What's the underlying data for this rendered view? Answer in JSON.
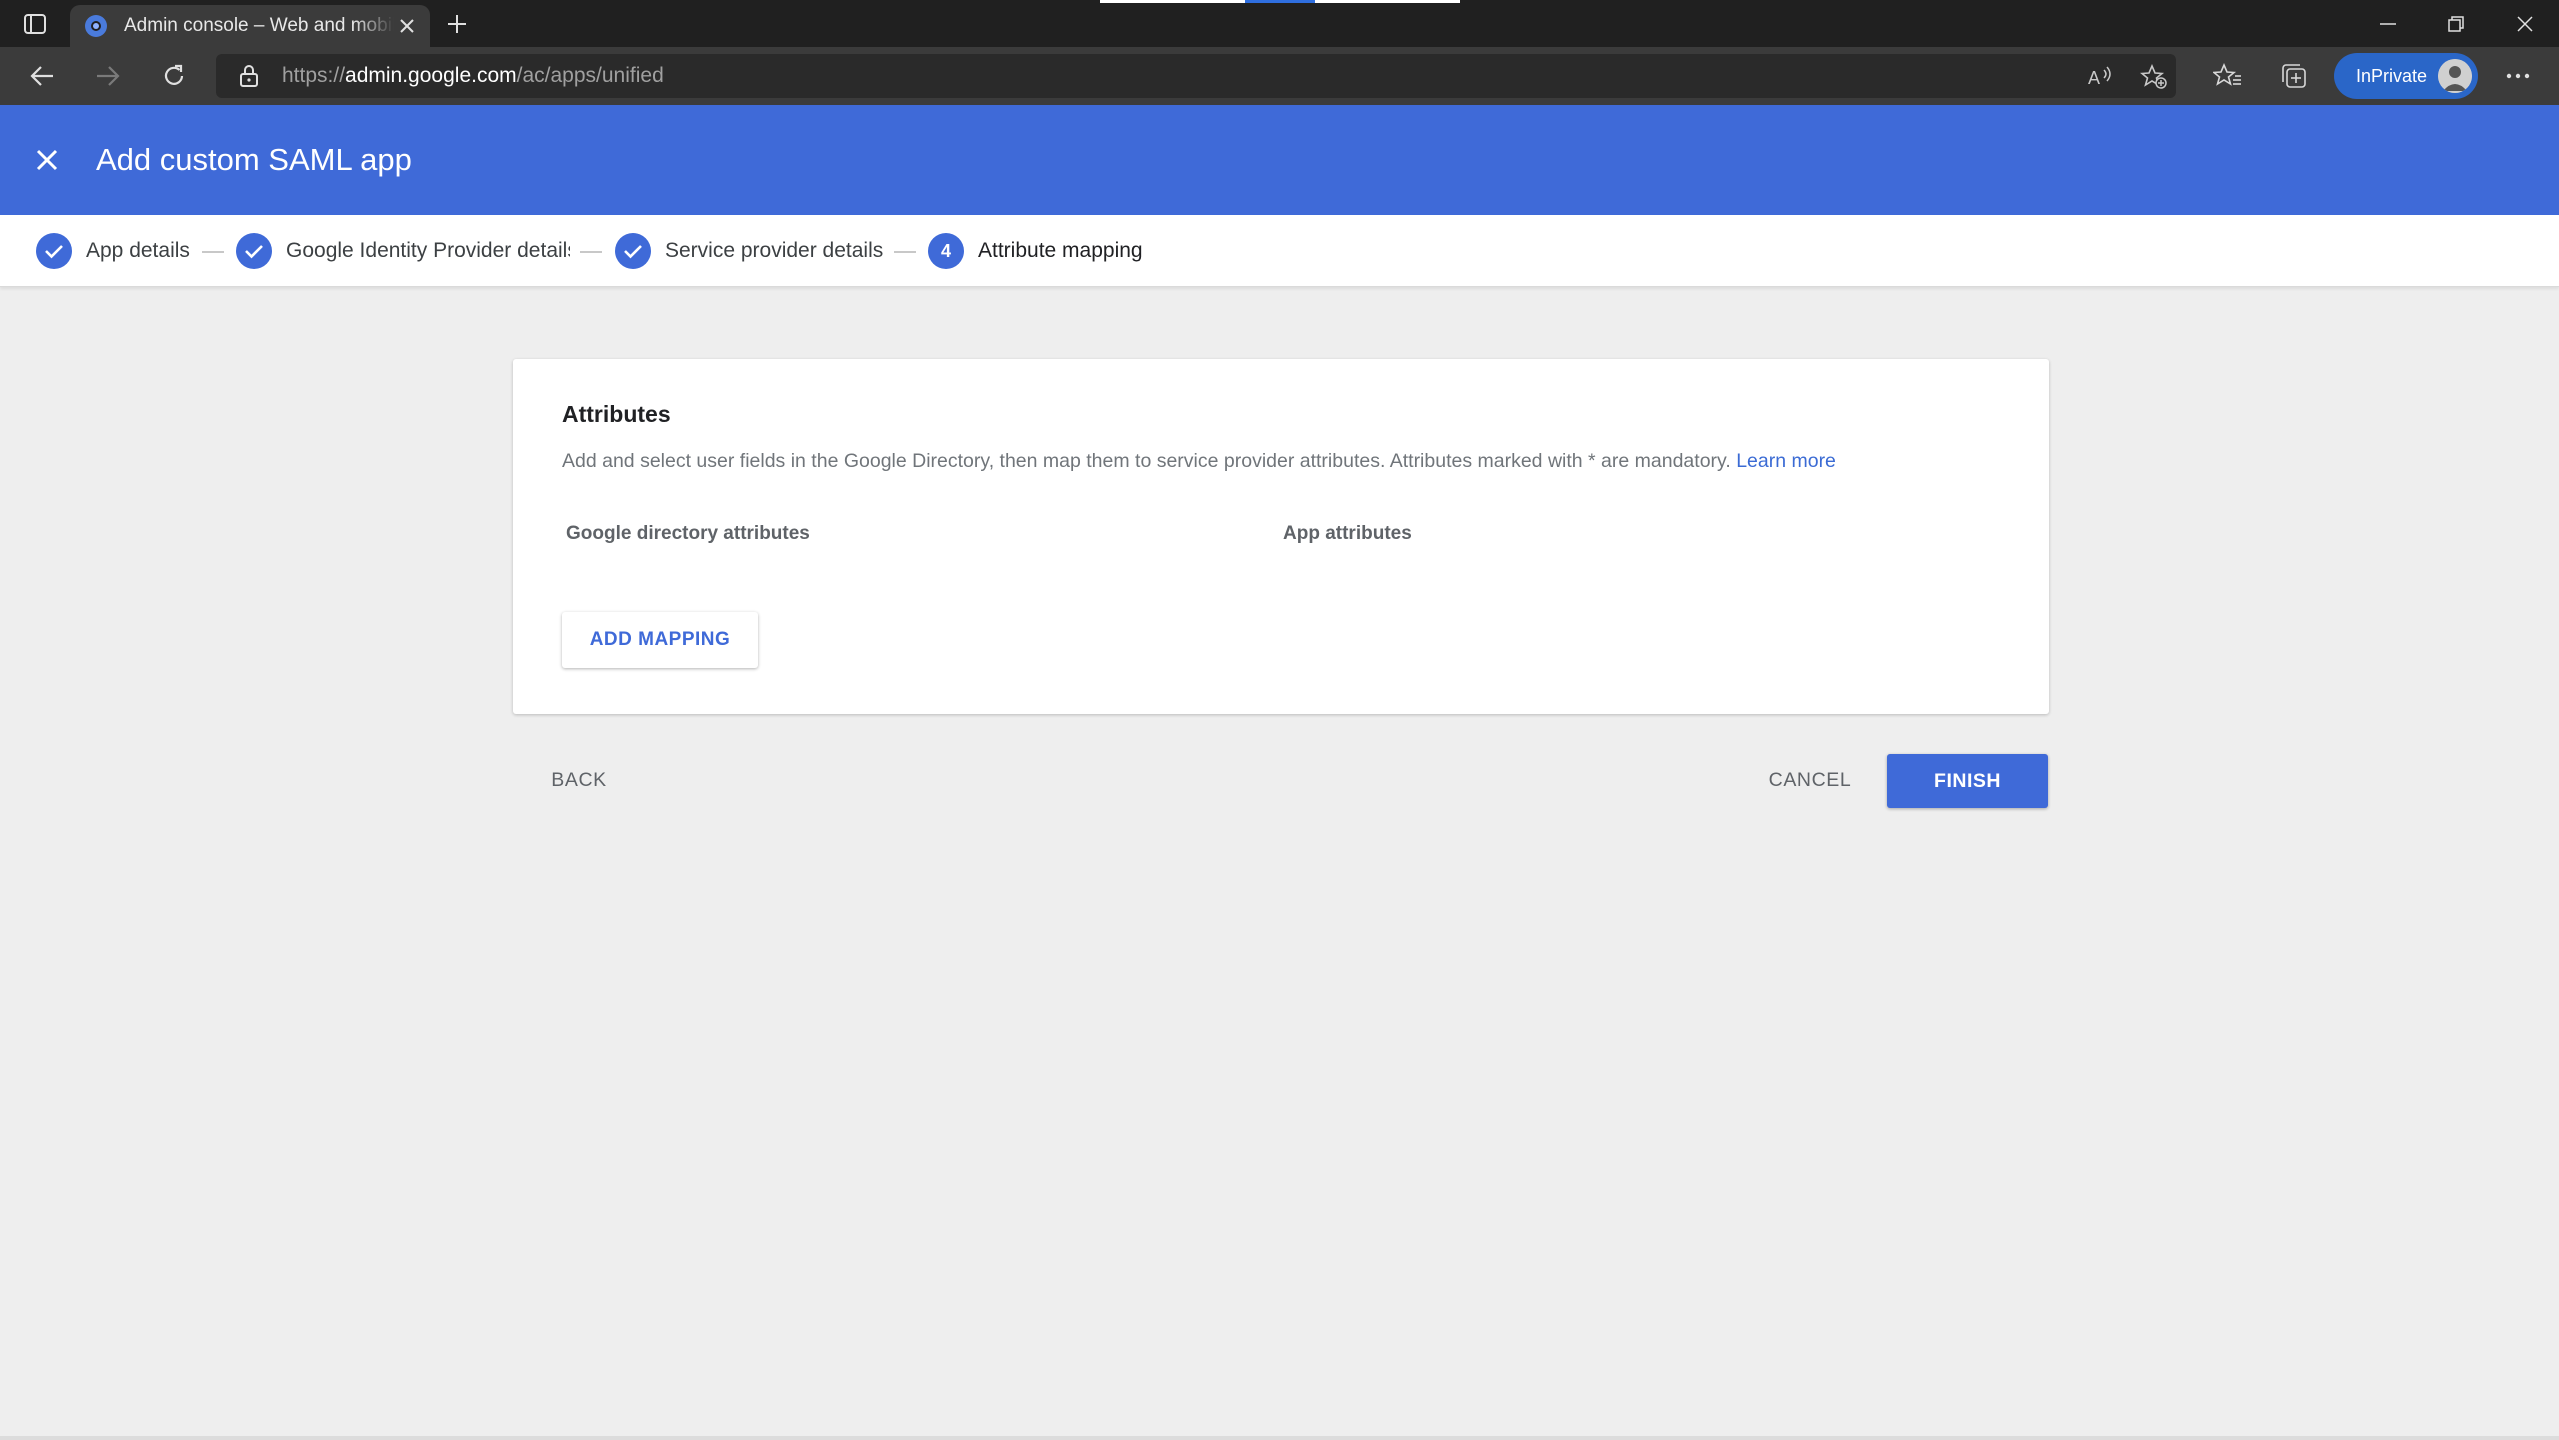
{
  "browser": {
    "tab_title": "Admin console – Web and mobile apps",
    "url_prefix": "https://",
    "url_host": "admin.google.com",
    "url_path": "/ac/apps/unified",
    "inprivate_label": "InPrivate"
  },
  "header": {
    "title": "Add custom SAML app"
  },
  "stepper": {
    "steps": [
      {
        "label": "App details",
        "state": "done"
      },
      {
        "label": "Google Identity Provider details",
        "state": "done"
      },
      {
        "label": "Service provider details",
        "state": "done"
      },
      {
        "label": "Attribute mapping",
        "state": "active",
        "number": "4"
      }
    ]
  },
  "card": {
    "title": "Attributes",
    "description": "Add and select user fields in the Google Directory, then map them to service provider attributes. Attributes marked with * are mandatory.",
    "learn_more": "Learn more",
    "col_directory": "Google directory attributes",
    "col_app": "App attributes",
    "add_mapping_label": "ADD MAPPING"
  },
  "footer": {
    "back_label": "BACK",
    "cancel_label": "CANCEL",
    "finish_label": "FINISH"
  },
  "colors": {
    "accent": "#3f6ad8",
    "background": "#eeeeee"
  }
}
